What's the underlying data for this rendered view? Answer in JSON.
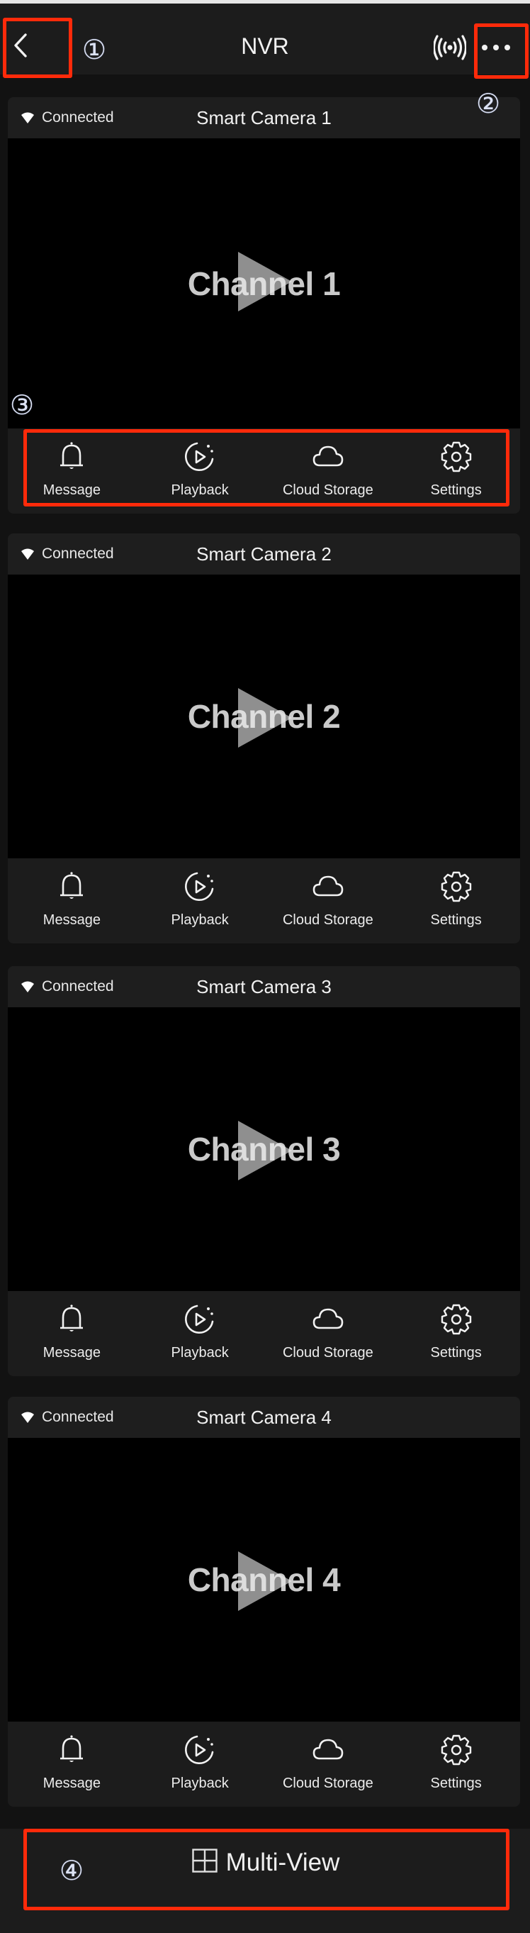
{
  "header": {
    "title": "NVR",
    "icons": {
      "back": "chevron-left-icon",
      "signal": "broadcast-signal-icon",
      "more": "more-horizontal-icon"
    }
  },
  "annotations": {
    "marker_1": "①",
    "marker_2": "②",
    "marker_3": "③",
    "marker_4": "④",
    "highlight_color": "#ff2a0a"
  },
  "cameras": [
    {
      "status": "Connected",
      "name": "Smart Camera 1",
      "channel": "Channel 1",
      "actions": [
        "Message",
        "Playback",
        "Cloud Storage",
        "Settings"
      ]
    },
    {
      "status": "Connected",
      "name": "Smart Camera 2",
      "channel": "Channel 2",
      "actions": [
        "Message",
        "Playback",
        "Cloud Storage",
        "Settings"
      ]
    },
    {
      "status": "Connected",
      "name": "Smart Camera 3",
      "channel": "Channel 3",
      "actions": [
        "Message",
        "Playback",
        "Cloud Storage",
        "Settings"
      ]
    },
    {
      "status": "Connected",
      "name": "Smart Camera 4",
      "channel": "Channel 4",
      "actions": [
        "Message",
        "Playback",
        "Cloud Storage",
        "Settings"
      ]
    }
  ],
  "bottom": {
    "multiview_label": "Multi-View",
    "multiview_icon": "grid-2x2-icon"
  },
  "colors": {
    "background": "#121212",
    "surface": "#1c1c1c",
    "video_bg": "#000000",
    "text": "#ffffff"
  }
}
